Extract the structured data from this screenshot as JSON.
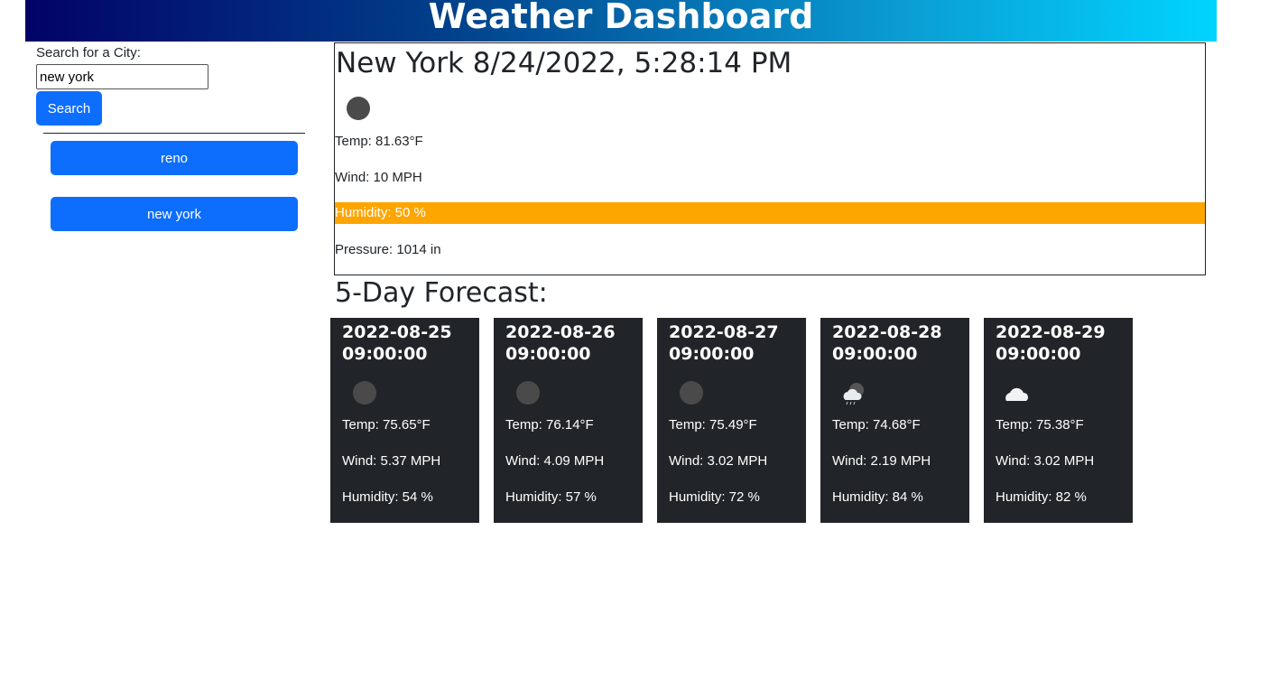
{
  "header": {
    "title": "Weather Dashboard"
  },
  "search": {
    "label": "Search for a City:",
    "value": "new york",
    "button_label": "Search"
  },
  "history": [
    {
      "label": "reno"
    },
    {
      "label": "new york"
    }
  ],
  "current": {
    "title": "New York 8/24/2022, 5:28:14 PM",
    "icon": "moon-icon",
    "temp": "Temp: 81.63°F",
    "wind": "Wind: 10 MPH",
    "humidity": "Humidity: 50 %",
    "pressure": "Pressure: 1014 in",
    "humidity_highlight_color": "#ffa500"
  },
  "forecast": {
    "title": "5-Day Forecast:",
    "days": [
      {
        "date": "2022-08-25 09:00:00",
        "icon": "moon-icon",
        "temp": "Temp: 75.65°F",
        "wind": "Wind: 5.37 MPH",
        "humidity": "Humidity: 54 %"
      },
      {
        "date": "2022-08-26 09:00:00",
        "icon": "moon-icon",
        "temp": "Temp: 76.14°F",
        "wind": "Wind: 4.09 MPH",
        "humidity": "Humidity: 57 %"
      },
      {
        "date": "2022-08-27 09:00:00",
        "icon": "moon-icon",
        "temp": "Temp: 75.49°F",
        "wind": "Wind: 3.02 MPH",
        "humidity": "Humidity: 72 %"
      },
      {
        "date": "2022-08-28 09:00:00",
        "icon": "rain-cloud-moon-icon",
        "temp": "Temp: 74.68°F",
        "wind": "Wind: 2.19 MPH",
        "humidity": "Humidity: 84 %"
      },
      {
        "date": "2022-08-29 09:00:00",
        "icon": "cloud-icon",
        "temp": "Temp: 75.38°F",
        "wind": "Wind: 3.02 MPH",
        "humidity": "Humidity: 82 %"
      }
    ]
  },
  "colors": {
    "accent": "#0d6efd",
    "card_bg": "#212529",
    "highlight": "#ffa500"
  }
}
